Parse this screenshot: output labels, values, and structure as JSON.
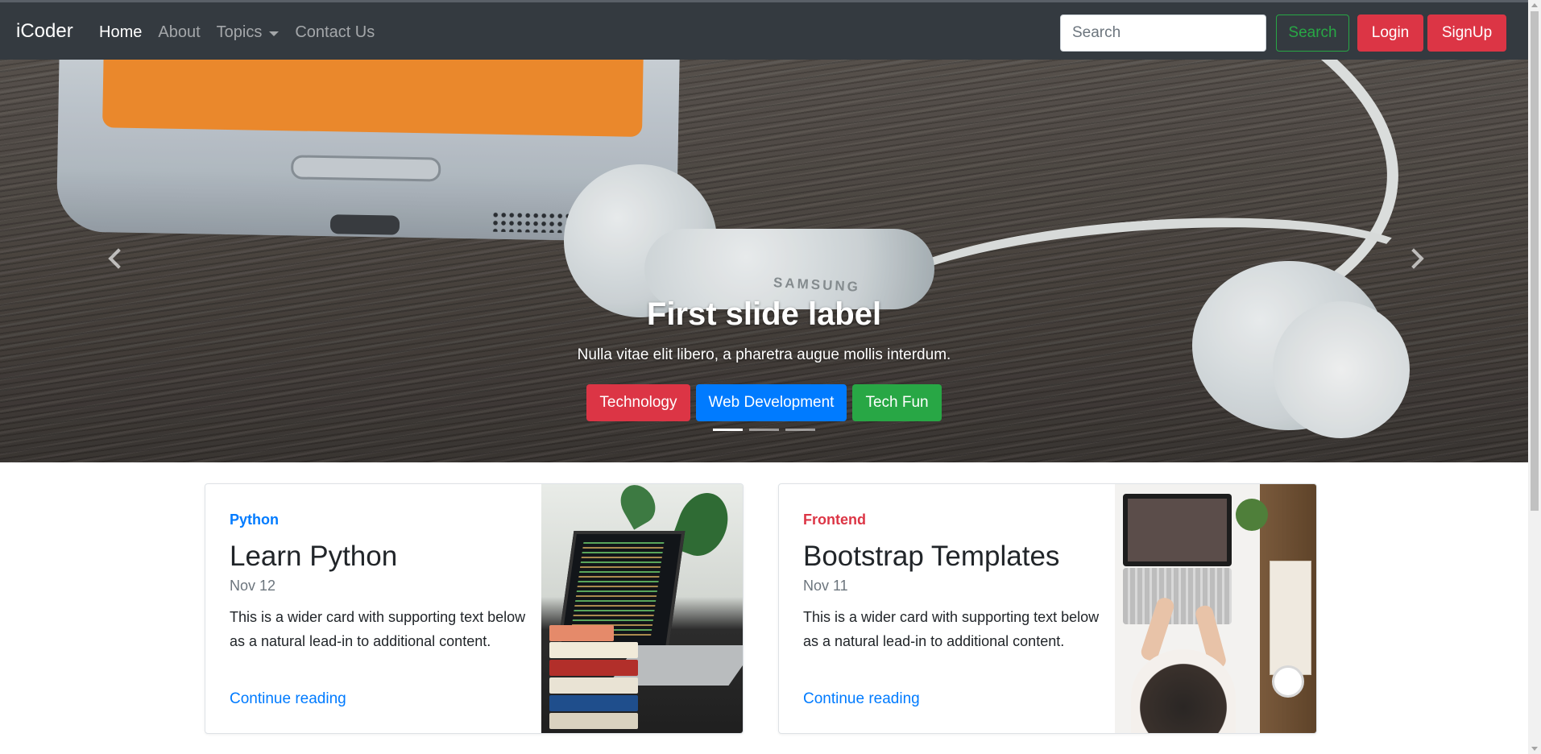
{
  "navbar": {
    "brand": "iCoder",
    "links": [
      {
        "label": "Home",
        "active": true
      },
      {
        "label": "About",
        "active": false
      },
      {
        "label": "Topics",
        "active": false,
        "dropdown": true
      },
      {
        "label": "Contact Us",
        "active": false
      }
    ],
    "search": {
      "placeholder": "Search",
      "value": ""
    },
    "search_button": "Search",
    "login_button": "Login",
    "signup_button": "SignUp"
  },
  "carousel": {
    "title": "First slide label",
    "text": "Nulla vitae elit libero, a pharetra augue mollis interdum.",
    "tags": [
      {
        "label": "Technology",
        "color": "#dc3545"
      },
      {
        "label": "Web Development",
        "color": "#007bff"
      },
      {
        "label": "Tech Fun",
        "color": "#28a745"
      }
    ],
    "indicators": {
      "count": 3,
      "active_index": 0
    },
    "image_brand_text": "SAMSUNG"
  },
  "cards": [
    {
      "category": "Python",
      "category_color": "#007bff",
      "title": "Learn Python",
      "date": "Nov 12",
      "text": "This is a wider card with supporting text below as a natural lead-in to additional content.",
      "link": "Continue reading"
    },
    {
      "category": "Frontend",
      "category_color": "#dc3545",
      "title": "Bootstrap Templates",
      "date": "Nov 11",
      "text": "This is a wider card with supporting text below as a natural lead-in to additional content.",
      "link": "Continue reading"
    }
  ],
  "colors": {
    "navbar_bg": "#343a40",
    "danger": "#dc3545",
    "primary": "#007bff",
    "success": "#28a745"
  }
}
